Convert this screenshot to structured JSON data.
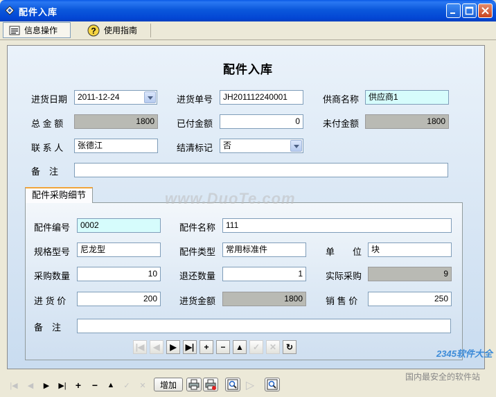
{
  "window": {
    "title": "配件入库"
  },
  "toolbar": {
    "tab_info": "信息操作",
    "tab_guide": "使用指南"
  },
  "form": {
    "title": "配件入库",
    "purchase_date_label": "进货日期",
    "purchase_date_value": "2011-12-24",
    "order_no_label": "进货单号",
    "order_no_value": "JH201112240001",
    "supplier_label": "供商名称",
    "supplier_value": "供应商1",
    "total_label": "总 金 额",
    "total_value": "1800",
    "paid_label": "已付金额",
    "paid_value": "0",
    "unpaid_label": "未付金额",
    "unpaid_value": "1800",
    "contact_label": "联 系 人",
    "contact_value": "张德江",
    "settled_label": "结清标记",
    "settled_value": "否",
    "remark_label": "备　注",
    "remark_value": ""
  },
  "detail": {
    "tab_label": "配件采购细节",
    "part_no_label": "配件编号",
    "part_no_value": "0002",
    "part_name_label": "配件名称",
    "part_name_value": "111",
    "spec_label": "规格型号",
    "spec_value": "尼龙型",
    "type_label": "配件类型",
    "type_value": "常用标准件",
    "unit_label": "单　　位",
    "unit_value": "块",
    "qty_label": "采购数量",
    "qty_value": "10",
    "return_label": "退还数量",
    "return_value": "1",
    "actual_label": "实际采购",
    "actual_value": "9",
    "price_label": "进 货 价",
    "price_value": "200",
    "amount_label": "进货金额",
    "amount_value": "1800",
    "sale_label": "销 售 价",
    "sale_value": "250",
    "remark_label": "备　注",
    "remark_value": ""
  },
  "navigator": {
    "first": "|◀",
    "prev": "◀",
    "next": "▶",
    "last": "▶|",
    "add": "+",
    "delete": "−",
    "edit": "▲",
    "post": "✓",
    "cancel": "✕",
    "refresh": "↻"
  },
  "status_bar": {
    "first": "|◀",
    "prev": "◀",
    "next": "▶",
    "last": "▶|",
    "add": "+",
    "delete": "−",
    "edit": "▲",
    "post": "✓",
    "cancel": "✕",
    "add_button": "增加"
  },
  "watermark": {
    "main": "www.DuoTe.com",
    "logo": "2345软件大全",
    "sub": "国内最安全的软件站"
  },
  "colors": {
    "title_bar": "#0a5ae6",
    "readonly_bg": "#b9bab4",
    "key_field_bg": "#d6fcfc"
  }
}
